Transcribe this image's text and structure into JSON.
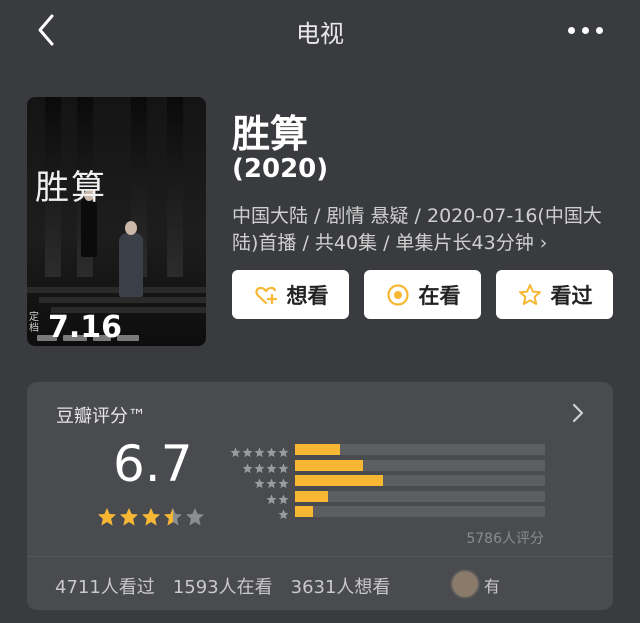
{
  "header": {
    "title": "电视",
    "back_icon": "chevron-left-icon",
    "more_icon": "more-dots-icon"
  },
  "poster": {
    "title_text": "胜算",
    "date_prefix": "定档",
    "date": "7.16"
  },
  "show": {
    "title": "胜算",
    "year": "(2020)",
    "meta": "中国大陆 / 剧情 悬疑 / 2020-07-16(中国大陆)首播 / 共40集 / 单集片长43分钟 ›"
  },
  "actions": [
    {
      "label": "想看",
      "icon": "heart-plus-icon"
    },
    {
      "label": "在看",
      "icon": "target-circle-icon"
    },
    {
      "label": "看过",
      "icon": "star-outline-icon"
    }
  ],
  "rating": {
    "label": "豆瓣评分™",
    "score": "6.7",
    "stars": 3.5,
    "count_text": "5786人评分",
    "distribution": [
      {
        "stars": 5,
        "fraction": 0.18
      },
      {
        "stars": 4,
        "fraction": 0.27
      },
      {
        "stars": 3,
        "fraction": 0.35
      },
      {
        "stars": 2,
        "fraction": 0.13
      },
      {
        "stars": 1,
        "fraction": 0.07
      }
    ]
  },
  "stats": {
    "watched": "4711人看过",
    "watching": "1593人在看",
    "want": "3631人想看",
    "friend_text": "有"
  },
  "colors": {
    "background": "#3a3b3e",
    "card": "#4a4b4f",
    "accent_bar": "#f7b733",
    "star": "#f7b733"
  }
}
